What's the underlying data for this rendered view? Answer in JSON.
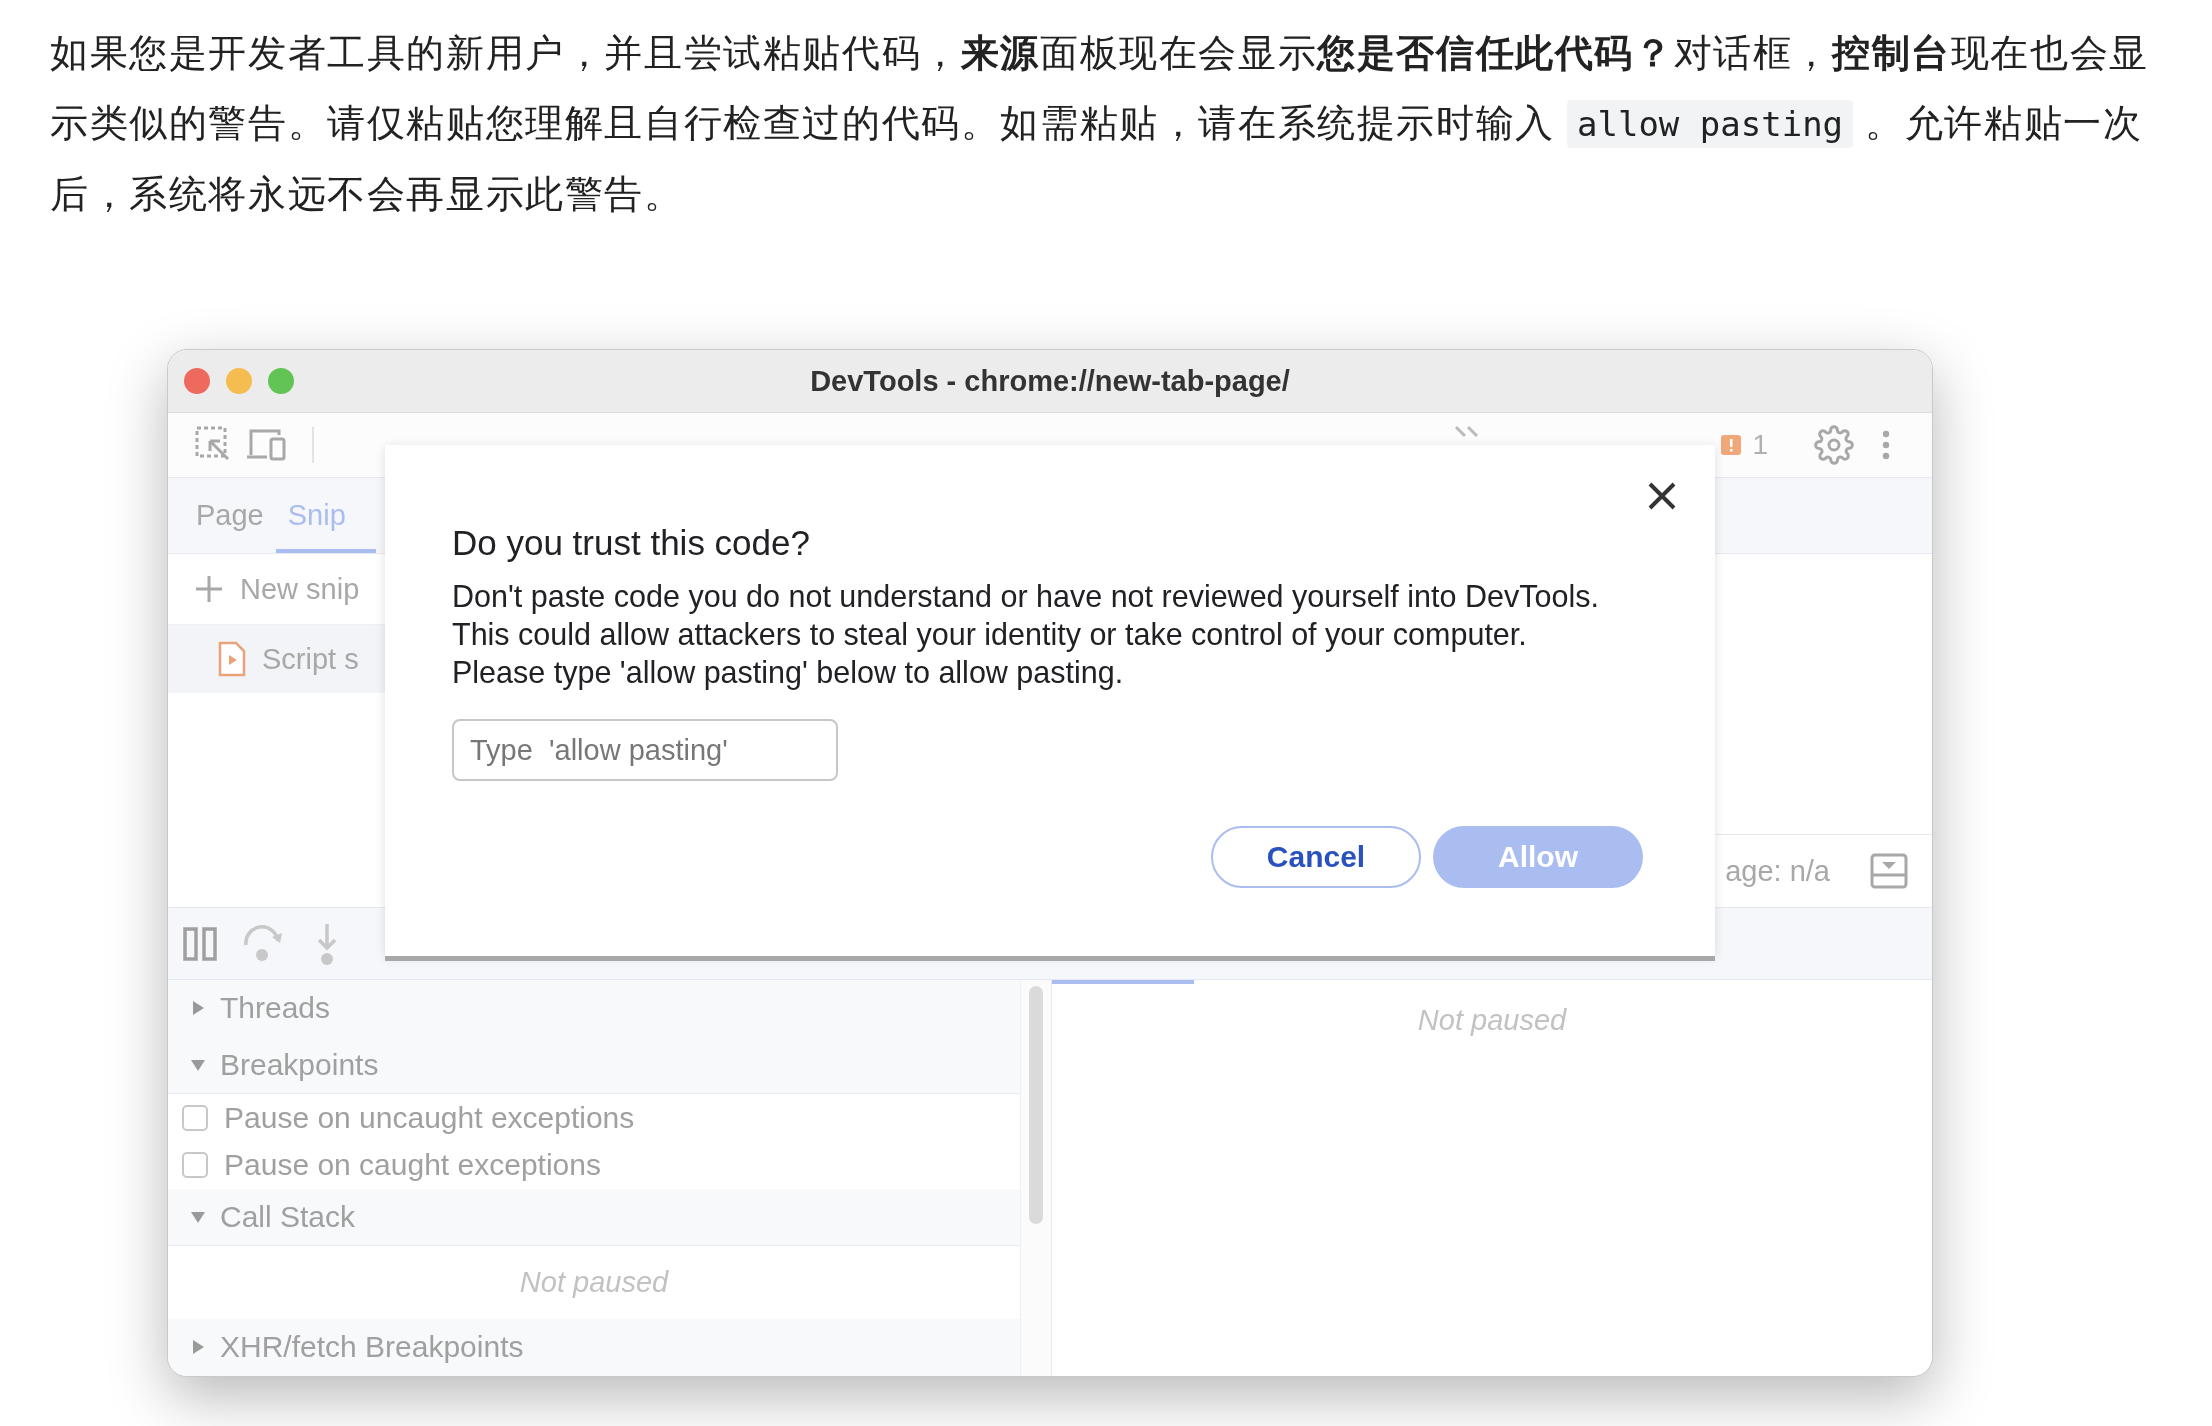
{
  "article": {
    "segments": [
      {
        "kind": "text",
        "text": "如果您是开发者工具的新用户，并且尝试粘贴代码，**来源**面板现在会显示**您是否信任此代码？**对话框，**控制台**现在也会显示类似的警告。请仅粘贴您理解且自行检查过的代码。如需粘贴，请在系统提示时输入 "
      },
      {
        "kind": "code",
        "text": "allow pasting"
      },
      {
        "kind": "text",
        "text": " 。允许粘贴一次后，系统将永远不会再显示此警告。"
      }
    ]
  },
  "window": {
    "title": "DevTools - chrome://new-tab-page/"
  },
  "toolbar": {
    "issues_count": "1"
  },
  "subtabs": [
    {
      "label": "Page",
      "selected": false
    },
    {
      "label": "Snip",
      "selected": true
    }
  ],
  "sidebar": {
    "new_snippet": "New snip",
    "items": [
      {
        "label": "Script s",
        "selected": true
      }
    ]
  },
  "editor_footer": {
    "text": "age: n/a"
  },
  "debugger": {
    "items": [
      {
        "kind": "section",
        "label": "Threads",
        "expanded": false
      },
      {
        "kind": "section",
        "label": "Breakpoints",
        "expanded": true
      },
      {
        "kind": "checkbox",
        "label": "Pause on uncaught exceptions",
        "checked": false
      },
      {
        "kind": "checkbox",
        "label": "Pause on caught exceptions",
        "checked": false
      },
      {
        "kind": "section",
        "label": "Call Stack",
        "expanded": true
      },
      {
        "kind": "note",
        "label": "Not paused"
      },
      {
        "kind": "section",
        "label": "XHR/fetch Breakpoints",
        "expanded": false
      }
    ]
  },
  "scope_pane": {
    "note": "Not paused"
  },
  "dialog": {
    "title": "Do you trust this code?",
    "message": "Don't paste code you do not understand or have not reviewed yourself into DevTools. This could allow attackers to steal your identity or take control of your computer. Please type 'allow pasting' below to allow pasting.",
    "input": {
      "placeholder": "Type  'allow pasting'"
    },
    "buttons": [
      {
        "label": "Cancel",
        "kind": "secondary",
        "disabled": false
      },
      {
        "label": "Allow",
        "kind": "primary",
        "disabled": true
      }
    ]
  }
}
